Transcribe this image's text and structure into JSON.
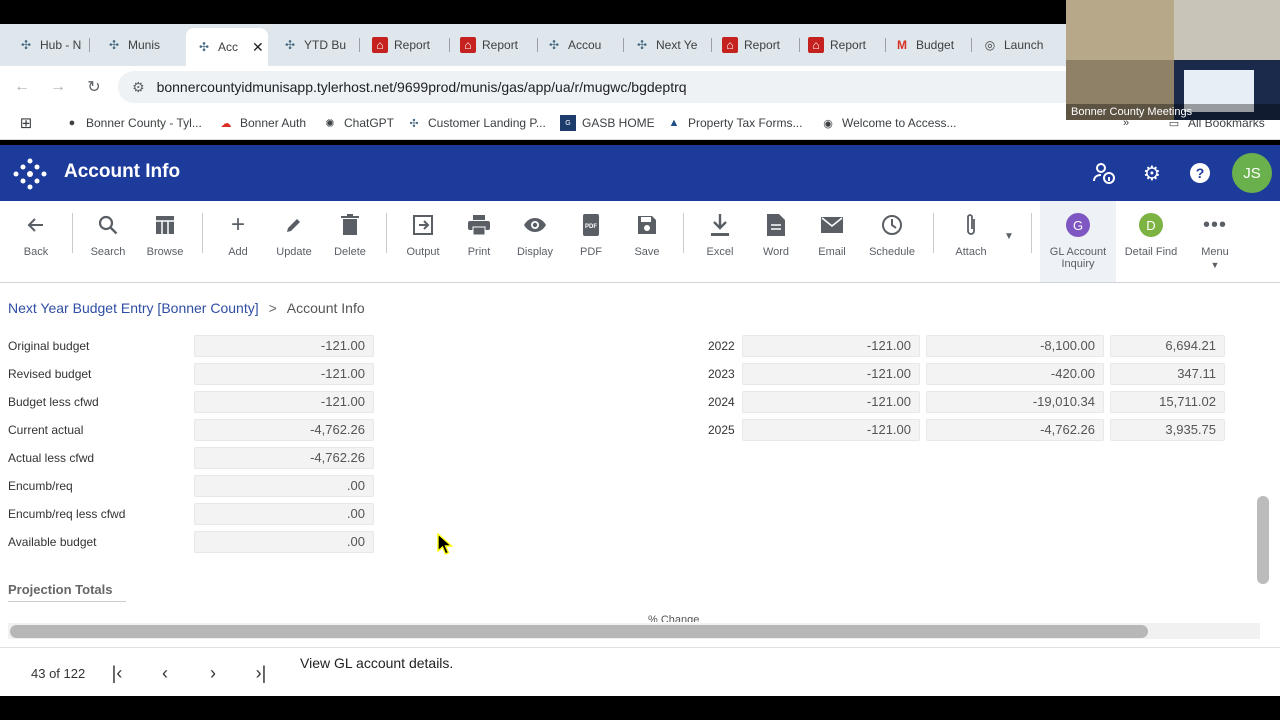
{
  "browser": {
    "tabs": [
      {
        "label": "Hub - N",
        "icon": "munis-icon"
      },
      {
        "label": "Munis",
        "icon": "munis-icon"
      },
      {
        "label": "Acc",
        "icon": "munis-icon",
        "active": true
      },
      {
        "label": "YTD Bu",
        "icon": "munis-icon"
      },
      {
        "label": "Report",
        "icon": "pdf-icon"
      },
      {
        "label": "Report",
        "icon": "pdf-icon"
      },
      {
        "label": "Accou",
        "icon": "munis-icon"
      },
      {
        "label": "Next Ye",
        "icon": "munis-icon"
      },
      {
        "label": "Report",
        "icon": "pdf-icon"
      },
      {
        "label": "Report",
        "icon": "pdf-icon"
      },
      {
        "label": "Budget",
        "icon": "gmail-icon"
      },
      {
        "label": "Launch",
        "icon": "globe-icon"
      }
    ],
    "url": "bonnercountyidmunisapp.tylerhost.net/9699prod/munis/gas/app/ua/r/mugwc/bgdeptrq",
    "bookmarks": [
      {
        "label": "Bonner County - Tyl...",
        "icon": "tyler-icon"
      },
      {
        "label": "Bonner Auth",
        "icon": "auth-icon"
      },
      {
        "label": "ChatGPT",
        "icon": "chatgpt-icon"
      },
      {
        "label": "Customer Landing P...",
        "icon": "munis-icon"
      },
      {
        "label": "GASB HOME",
        "icon": "gasb-icon"
      },
      {
        "label": "Property Tax Forms...",
        "icon": "idaho-icon"
      },
      {
        "label": "Welcome to Access...",
        "icon": "globe-icon"
      }
    ],
    "all_bookmarks": "All Bookmarks"
  },
  "app": {
    "title": "Account Info",
    "avatar_initials": "JS",
    "brand_color": "#1d3b9b"
  },
  "toolbar": {
    "back": "Back",
    "search": "Search",
    "browse": "Browse",
    "add": "Add",
    "update": "Update",
    "delete": "Delete",
    "output": "Output",
    "print": "Print",
    "display": "Display",
    "pdf": "PDF",
    "save": "Save",
    "excel": "Excel",
    "word": "Word",
    "email": "Email",
    "schedule": "Schedule",
    "attach": "Attach",
    "gl_account_inquiry": "GL Account Inquiry",
    "gl_badge": "G",
    "detail_find": "Detail Find",
    "detail_badge": "D",
    "menu": "Menu"
  },
  "breadcrumb": {
    "parent": "Next Year Budget Entry [Bonner County]",
    "separator": ">",
    "current": "Account Info"
  },
  "budget_fields": [
    {
      "label": "Original budget",
      "value": "-121.00"
    },
    {
      "label": "Revised budget",
      "value": "-121.00"
    },
    {
      "label": "Budget less cfwd",
      "value": "-121.00"
    },
    {
      "label": "Current actual",
      "value": "-4,762.26"
    },
    {
      "label": "Actual less cfwd",
      "value": "-4,762.26"
    },
    {
      "label": "Encumb/req",
      "value": ".00"
    },
    {
      "label": "Encumb/req less cfwd",
      "value": ".00"
    },
    {
      "label": "Available budget",
      "value": ".00"
    }
  ],
  "history": [
    {
      "year": "2022",
      "budget": "-121.00",
      "actual": "-8,100.00",
      "variance": "6,694.21"
    },
    {
      "year": "2023",
      "budget": "-121.00",
      "actual": "-420.00",
      "variance": "347.11"
    },
    {
      "year": "2024",
      "budget": "-121.00",
      "actual": "-19,010.34",
      "variance": "15,711.02"
    },
    {
      "year": "2025",
      "budget": "-121.00",
      "actual": "-4,762.26",
      "variance": "3,935.75"
    }
  ],
  "projection": {
    "title": "Projection Totals",
    "pct_change": "% Change"
  },
  "footer": {
    "record_count": "43 of 122",
    "status": "View GL account details."
  },
  "video": {
    "label": "Bonner County Meetings"
  }
}
